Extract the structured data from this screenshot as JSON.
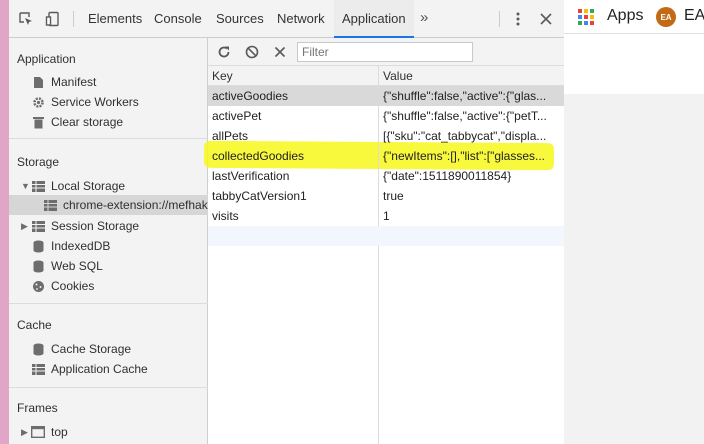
{
  "devtools": {
    "tabs": [
      "Elements",
      "Console",
      "Sources",
      "Network",
      "Application"
    ],
    "active_tab": "Application",
    "more_tabs": "»",
    "menu_icon": "kebab-menu-icon",
    "close_icon": "close-icon"
  },
  "sidebar": {
    "application": {
      "title": "Application",
      "items": [
        {
          "label": "Manifest",
          "icon": "file-icon"
        },
        {
          "label": "Service Workers",
          "icon": "gear-icon"
        },
        {
          "label": "Clear storage",
          "icon": "trash-icon"
        }
      ]
    },
    "storage": {
      "title": "Storage",
      "ghost_text": "Stor",
      "local_storage": "Local Storage",
      "local_storage_child": "chrome-extension://mefhak",
      "items": [
        {
          "label": "Session Storage",
          "icon": "grid-icon"
        },
        {
          "label": "IndexedDB",
          "icon": "database-icon"
        },
        {
          "label": "Web SQL",
          "icon": "database-icon"
        },
        {
          "label": "Cookies",
          "icon": "cookie-icon"
        }
      ]
    },
    "cache": {
      "title": "Cache",
      "items": [
        {
          "label": "Cache Storage",
          "icon": "database-icon"
        },
        {
          "label": "Application Cache",
          "icon": "grid-icon"
        }
      ]
    },
    "frames": {
      "title": "Frames",
      "items": [
        {
          "label": "top",
          "icon": "frame-icon"
        }
      ]
    }
  },
  "storage_panel": {
    "filter_placeholder": "Filter",
    "columns": [
      "Key",
      "Value"
    ],
    "rows": [
      {
        "key": "activeGoodies",
        "value": "{\"shuffle\":false,\"active\":{\"glas..."
      },
      {
        "key": "activePet",
        "value": "{\"shuffle\":false,\"active\":{\"petT..."
      },
      {
        "key": "allPets",
        "value": "[{\"sku\":\"cat_tabbycat\",\"displa..."
      },
      {
        "key": "collectedGoodies",
        "value": "{\"newItems\":[],\"list\":[\"glasses..."
      },
      {
        "key": "lastVerification",
        "value": "{\"date\":1511890011854}"
      },
      {
        "key": "tabbyCatVersion1",
        "value": "true"
      },
      {
        "key": "visits",
        "value": "1"
      }
    ],
    "selected_row": 0,
    "highlighted_row": 3,
    "highlight_color": "#f7f71a"
  },
  "browser": {
    "bookmarks": [
      {
        "label": "Apps",
        "icon": "apps-grid-icon"
      },
      {
        "label": "EA",
        "icon": "ea-icon",
        "icon_text": "EA"
      }
    ]
  }
}
